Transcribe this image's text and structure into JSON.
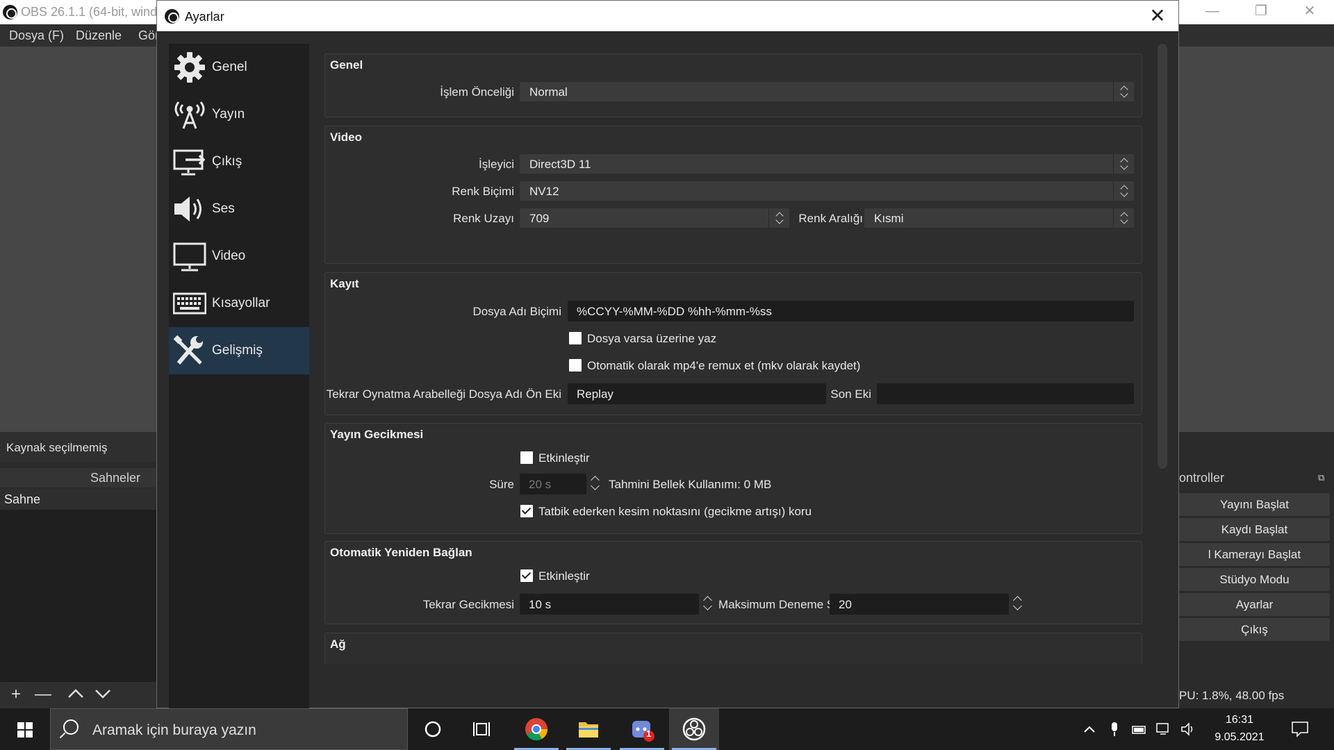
{
  "obs": {
    "title": "OBS 26.1.1 (64-bit, wind",
    "menu": [
      "Dosya (F)",
      "Düzenle",
      "Gör"
    ],
    "source_status": "Kaynak seçilmemiş",
    "scenes": {
      "header": "Sahneler",
      "items": [
        "Sahne"
      ]
    },
    "controls": {
      "header": "ontroller",
      "buttons": [
        "Yayını Başlat",
        "Kaydı Başlat",
        "l Kamerayı Başlat",
        "Stüdyo Modu",
        "Ayarlar",
        "Çıkış"
      ]
    },
    "stats": "PU: 1.8%, 48.00 fps"
  },
  "dialog": {
    "title": "Ayarlar",
    "nav": [
      {
        "label": "Genel",
        "icon": "gear-icon"
      },
      {
        "label": "Yayın",
        "icon": "broadcast-icon"
      },
      {
        "label": "Çıkış",
        "icon": "output-icon"
      },
      {
        "label": "Ses",
        "icon": "speaker-icon"
      },
      {
        "label": "Video",
        "icon": "monitor-icon"
      },
      {
        "label": "Kısayollar",
        "icon": "keyboard-icon"
      },
      {
        "label": "Gelişmiş",
        "icon": "tools-icon",
        "active": true
      }
    ],
    "general": {
      "title": "Genel",
      "priority_label": "İşlem Önceliği",
      "priority_value": "Normal"
    },
    "video": {
      "title": "Video",
      "renderer_label": "İşleyici",
      "renderer_value": "Direct3D 11",
      "color_format_label": "Renk Biçimi",
      "color_format_value": "NV12",
      "color_space_label": "Renk Uzayı",
      "color_space_value": "709",
      "color_range_label": "Renk Aralığı",
      "color_range_value": "Kısmi"
    },
    "recording": {
      "title": "Kayıt",
      "filename_format_label": "Dosya Adı Biçimi",
      "filename_format_value": "%CCYY-%MM-%DD %hh-%mm-%ss",
      "overwrite_label": "Dosya varsa üzerine yaz",
      "overwrite_checked": false,
      "remux_label": "Otomatik olarak mp4'e remux et (mkv olarak kaydet)",
      "remux_checked": false,
      "replay_prefix_label": "Tekrar Oynatma Arabelleği Dosya Adı Ön Eki",
      "replay_prefix_value": "Replay",
      "suffix_label": "Son Eki",
      "suffix_value": ""
    },
    "stream_delay": {
      "title": "Yayın Gecikmesi",
      "enable_label": "Etkinleştir",
      "enable_checked": false,
      "duration_label": "Süre",
      "duration_value": "20 s",
      "memory_label": "Tahmini Bellek Kullanımı: 0 MB",
      "preserve_label": "Tatbik ederken kesim noktasını (gecikme artışı) koru",
      "preserve_checked": true
    },
    "reconnect": {
      "title": "Otomatik Yeniden Bağlan",
      "enable_label": "Etkinleştir",
      "enable_checked": true,
      "retry_delay_label": "Tekrar Gecikmesi",
      "retry_delay_value": "10 s",
      "max_retries_label": "Maksimum Deneme Sayısı",
      "max_retries_value": "20"
    },
    "network": {
      "title": "Ağ"
    }
  },
  "taskbar": {
    "search_placeholder": "Aramak için buraya yazın",
    "apps": [
      "cortana-icon",
      "task-view-icon",
      "chrome-icon",
      "file-explorer-icon",
      "discord-icon",
      "obs-icon"
    ],
    "discord_badge": "1",
    "time": "16:31",
    "date": "9.05.2021"
  },
  "colors": {
    "active_nav": "#23374a",
    "dialog_bg": "#2b2b2b",
    "combo_bg": "#3b3b3b",
    "input_bg": "#1d1d1d"
  }
}
